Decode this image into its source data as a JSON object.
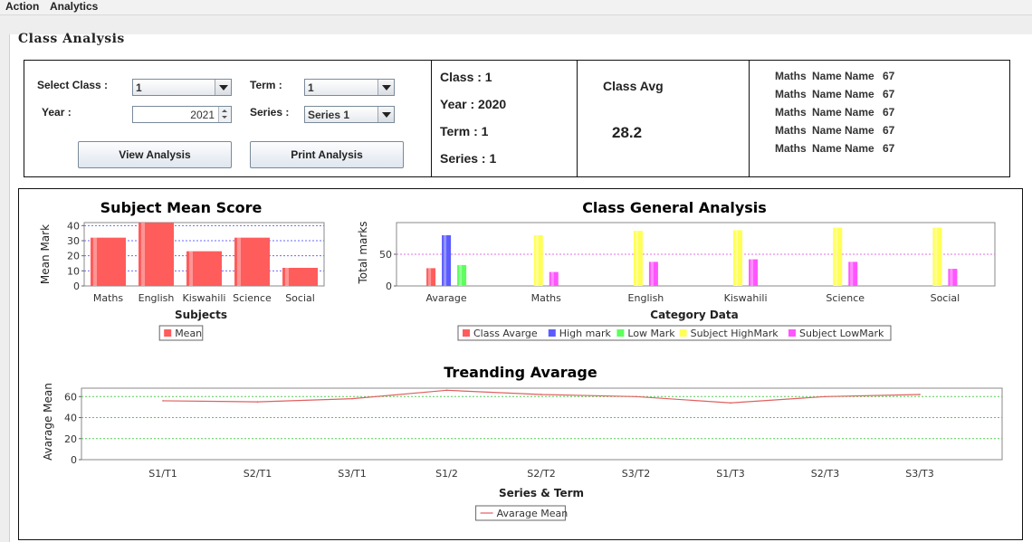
{
  "menu": {
    "items": [
      "Action",
      "Analytics"
    ]
  },
  "page_title": "Class Analysis",
  "controls": {
    "select_class_label": "Select Class :",
    "select_class_value": "1",
    "term_label": "Term :",
    "term_value": "1",
    "year_label": "Year :",
    "year_value": "2021",
    "series_label": "Series :",
    "series_value": "Series 1",
    "view_button": "View Analysis",
    "print_button": "Print Analysis"
  },
  "info": {
    "class": "Class : 1",
    "year": "Year : 2020",
    "term": "Term : 1",
    "series": "Series : 1"
  },
  "class_avg": {
    "title": "Class Avg",
    "value": "28.2"
  },
  "top_students": [
    {
      "subject": "Maths",
      "name": "Name Name",
      "mark": "67"
    },
    {
      "subject": "Maths",
      "name": "Name Name",
      "mark": "67"
    },
    {
      "subject": "Maths",
      "name": "Name Name",
      "mark": "67"
    },
    {
      "subject": "Maths",
      "name": "Name Name",
      "mark": "67"
    },
    {
      "subject": "Maths",
      "name": "Name Name",
      "mark": "67"
    }
  ],
  "colors": {
    "red": "#ff5c5c",
    "blue": "#5b5bff",
    "green": "#5cff5c",
    "yellow": "#ffff55",
    "magenta": "#ff55ff",
    "trend": "#e06060"
  },
  "chart_data": [
    {
      "type": "bar",
      "title": "Subject Mean Score",
      "xlabel": "Subjects",
      "ylabel": "Mean Mark",
      "categories": [
        "Maths",
        "English",
        "Kiswahili",
        "Science",
        "Social"
      ],
      "series": [
        {
          "name": "Mean",
          "values": [
            32,
            42,
            23,
            32,
            12
          ]
        }
      ],
      "ylim": [
        0,
        42
      ],
      "yticks": [
        "0",
        "10",
        "20",
        "30",
        "40"
      ],
      "grid": true,
      "legend": "bottom"
    },
    {
      "type": "bar",
      "title": "Class General Analysis",
      "xlabel": "Category Data",
      "ylabel": "Total marks",
      "categories": [
        "Avarage",
        "Maths",
        "English",
        "Kiswahili",
        "Science",
        "Social"
      ],
      "series": [
        {
          "name": "Class Avarge",
          "values": [
            28,
            null,
            null,
            null,
            null,
            null
          ]
        },
        {
          "name": "High mark",
          "values": [
            80,
            null,
            null,
            null,
            null,
            null
          ]
        },
        {
          "name": "Low Mark",
          "values": [
            33,
            null,
            null,
            null,
            null,
            null
          ]
        },
        {
          "name": "Subject HighMark",
          "values": [
            null,
            80,
            87,
            88,
            92,
            92
          ]
        },
        {
          "name": "Subject LowMark",
          "values": [
            null,
            22,
            38,
            42,
            38,
            27
          ]
        }
      ],
      "ylim": [
        0,
        100
      ],
      "yticks": [
        "0",
        "50"
      ],
      "grid": true,
      "legend": "bottom"
    },
    {
      "type": "line",
      "title": "Treanding Avarage",
      "xlabel": "Series & Term",
      "ylabel": "Avarage Mean",
      "categories": [
        "S1/T1",
        "S2/T1",
        "S3/T1",
        "S1/2",
        "S2/T2",
        "S3/T2",
        "S1/T3",
        "S2/T3",
        "S3/T3"
      ],
      "series": [
        {
          "name": "Avarage Mean",
          "values": [
            56,
            55,
            58,
            66,
            62,
            60,
            54,
            60,
            62
          ]
        }
      ],
      "ylim": [
        0,
        68
      ],
      "yticks": [
        "0",
        "20",
        "40",
        "60"
      ],
      "grid": true,
      "legend": "bottom"
    }
  ]
}
